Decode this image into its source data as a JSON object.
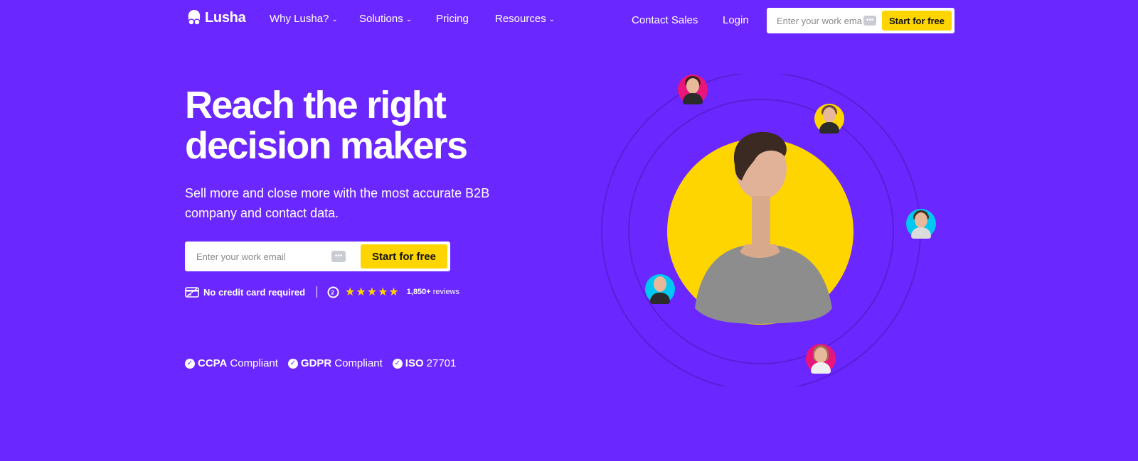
{
  "brand": {
    "name": "Lusha",
    "accent_bg": "#6B27FF",
    "cta_color": "#FFD500"
  },
  "nav": {
    "links": [
      {
        "label": "Why Lusha?",
        "has_dropdown": true
      },
      {
        "label": "Solutions",
        "has_dropdown": true
      },
      {
        "label": "Pricing",
        "has_dropdown": false
      },
      {
        "label": "Resources",
        "has_dropdown": true
      }
    ],
    "contact_sales": "Contact Sales",
    "login": "Login",
    "email_placeholder": "Enter your work email",
    "cta_label": "Start for free"
  },
  "hero": {
    "headline_line1": "Reach the right",
    "headline_line2": "decision makers",
    "subhead": "Sell more and close more with the most accurate B2B company and contact data.",
    "email_placeholder": "Enter your work email",
    "cta_label": "Start for free",
    "no_credit_card": "No credit card required",
    "rating_stars": 5,
    "stars_glyphs": "★★★★★",
    "reviews_count": "1,850+",
    "reviews_word": "reviews"
  },
  "compliance": [
    {
      "bold": "CCPA",
      "rest": "Compliant"
    },
    {
      "bold": "GDPR",
      "rest": "Compliant"
    },
    {
      "bold": "ISO",
      "rest": "27701"
    }
  ],
  "illustration": {
    "main_circle_color": "#FFD500",
    "avatar_ring_colors": [
      "#E8157A",
      "#FFD500",
      "#00C8F0",
      "#00C8F0",
      "#E8157A"
    ]
  }
}
